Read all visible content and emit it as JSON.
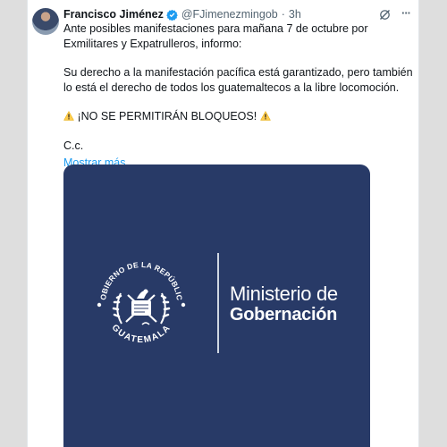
{
  "tweet": {
    "author_name": "Francisco Jiménez",
    "handle": "@FJimenezmingob",
    "separator": "·",
    "time": "3h",
    "more_glyph": "···",
    "paragraphs": [
      "Ante posibles manifestaciones para mañana 7 de octubre por Exmilitares y Expatrulleros, informo:",
      "Su derecho a la manifestación pacífica está garantizado, pero también lo está el derecho de todos los guatemaltecos a la libre locomoción."
    ],
    "alert_text": "¡NO SE PERMITIRÁN BLOQUEOS!",
    "cc": "C.c.",
    "show_more": "Mostrar más",
    "icons": [
      "verified-badge-icon",
      "grok-icon",
      "more-options-icon",
      "warning-icon"
    ],
    "colors": {
      "link": "#1d9bf0",
      "verified": "#1d9bf0",
      "media_bg": "#283a67"
    }
  },
  "media": {
    "seal_top_text": "GOBIERNO DE LA REPÚBLICA",
    "seal_bottom_text": "GUATEMALA",
    "ministry_line1": "Ministerio de",
    "ministry_line2": "Gobernación"
  }
}
